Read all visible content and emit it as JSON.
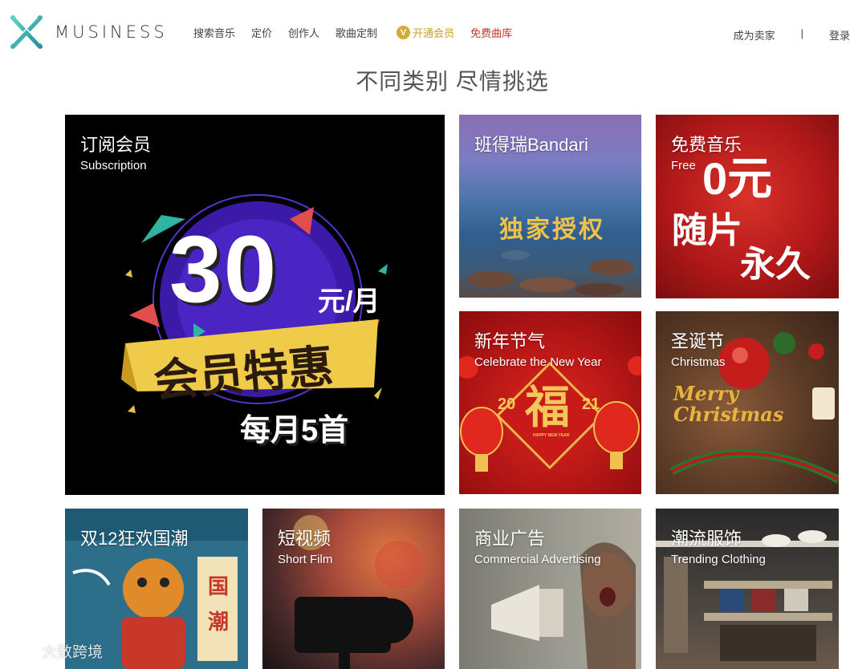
{
  "brand": {
    "name": "MUSINESS"
  },
  "nav": {
    "items": [
      "搜索音乐",
      "定价",
      "创作人",
      "歌曲定制"
    ],
    "vip_label": "开通会员",
    "vip_badge": "V",
    "free_label": "免费曲库"
  },
  "header_right": {
    "seller": "成为卖家",
    "separator": "|",
    "login": "登录"
  },
  "section_title": "不同类别 尽情挑选",
  "cards": {
    "subscription": {
      "title": "订阅会员",
      "subtitle": "Subscription",
      "big_number": "30",
      "per_month": "元/月",
      "banner": "会员特惠",
      "monthly": "每月5首"
    },
    "bandari": {
      "title": "班得瑞Bandari",
      "overlay": "独家授权"
    },
    "free": {
      "title": "免费音乐",
      "subtitle": "Free",
      "zero": "0元",
      "line1": "随片",
      "line2": "永久"
    },
    "newyear": {
      "title": "新年节气",
      "subtitle": "Celebrate the New Year",
      "fu": "福",
      "year_left": "20",
      "year_right": "21",
      "happy": "HAPPY NEW YEAR"
    },
    "christmas": {
      "title": "圣诞节",
      "subtitle": "Christmas",
      "script": "Merry Christmas"
    },
    "guochao": {
      "title": "双12狂欢国潮",
      "side": "国潮"
    },
    "shortfilm": {
      "title": "短视频",
      "subtitle": "Short Film"
    },
    "commercial": {
      "title": "商业广告",
      "subtitle": "Commercial Advertising"
    },
    "clothing": {
      "title": "潮流服饰",
      "subtitle": "Trending Clothing"
    }
  },
  "watermark": "大数跨境",
  "colors": {
    "vip_gold": "#c9a227",
    "free_red": "#c0392b",
    "logo_teal": "#3fb8b0"
  }
}
